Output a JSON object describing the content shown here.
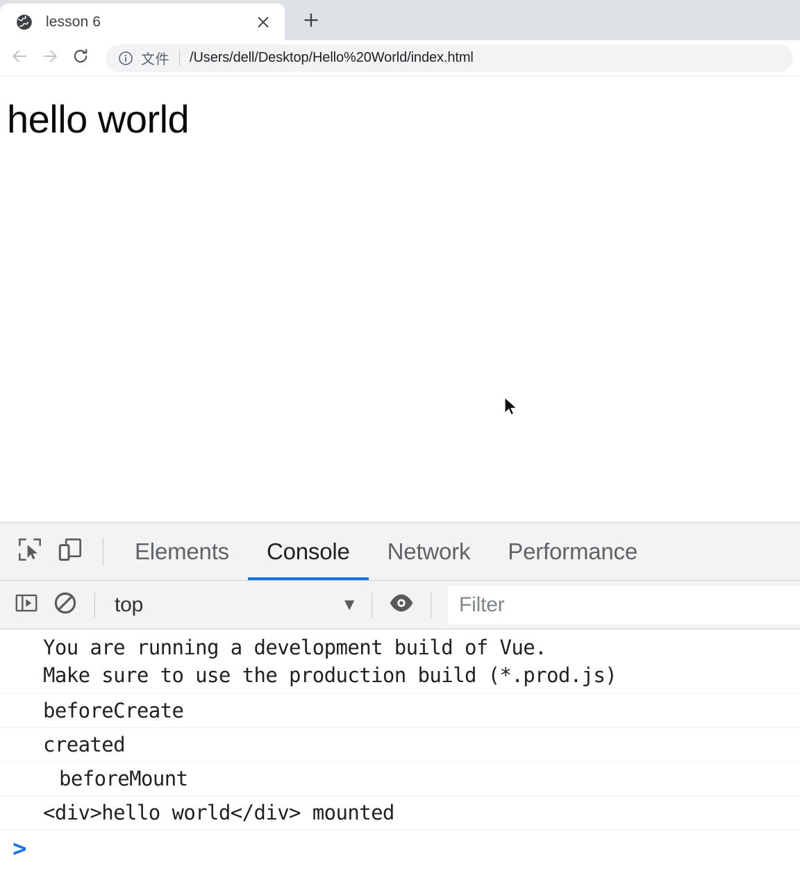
{
  "browser": {
    "tab": {
      "title": "lesson 6",
      "favicon_icon": "globe-icon",
      "close_icon": "close-icon"
    },
    "new_tab_icon": "plus-icon",
    "nav": {
      "back_icon": "arrow-left-icon",
      "forward_icon": "arrow-right-icon",
      "reload_icon": "reload-icon"
    },
    "omnibox": {
      "info_icon": "info-circle-icon",
      "scheme_label": "文件",
      "url": "/Users/dell/Desktop/Hello%20World/index.html"
    }
  },
  "page": {
    "heading": "hello world"
  },
  "devtools": {
    "toolbar": {
      "inspect_icon": "inspect-element-icon",
      "device_toolbar_icon": "device-toolbar-icon"
    },
    "tabs": [
      {
        "label": "Elements",
        "selected": false
      },
      {
        "label": "Console",
        "selected": true
      },
      {
        "label": "Network",
        "selected": false
      },
      {
        "label": "Performance",
        "selected": false
      }
    ],
    "console_filterbar": {
      "sidebar_icon": "console-sidebar-icon",
      "clear_icon": "clear-console-icon",
      "context_value": "top",
      "context_caret_icon": "chevron-down-icon",
      "eye_icon": "live-expression-eye-icon",
      "filter_placeholder": "Filter"
    },
    "console_messages": [
      {
        "text": "You are running a development build of Vue.\nMake sure to use the production build (*.prod.js)",
        "indent": 1,
        "multiline": true
      },
      {
        "text": "beforeCreate",
        "indent": 1,
        "multiline": false
      },
      {
        "text": "created",
        "indent": 1,
        "multiline": false
      },
      {
        "text": "beforeMount",
        "indent": 2,
        "multiline": false
      },
      {
        "text": "<div>hello world</div> mounted",
        "indent": 1,
        "multiline": false
      }
    ],
    "prompt_caret": ">"
  },
  "colors": {
    "accent": "#1a73e8",
    "tabstrip_bg": "#dee1e6",
    "omnibox_bg": "#f1f3f4",
    "devtools_bg": "#f3f3f3"
  }
}
